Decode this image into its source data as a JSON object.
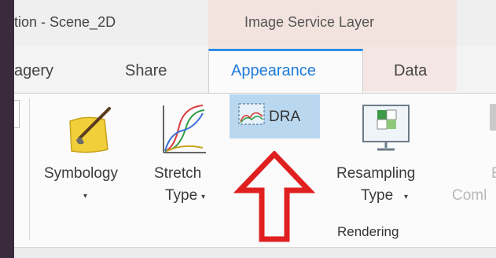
{
  "window": {
    "title": "tion - Scene_2D",
    "context_group": "Image Service Layer"
  },
  "tabs": {
    "imagery": "agery",
    "share": "Share",
    "appearance": "Appearance",
    "data": "Data",
    "active": "Appearance"
  },
  "ribbon": {
    "symbology": {
      "label": "Symbology",
      "caret": "▾"
    },
    "stretch_type": {
      "line1": "Stretch",
      "line2": "Type",
      "caret": "▾"
    },
    "dra": {
      "label": "DRA"
    },
    "resampling_type": {
      "line1": "Resampling",
      "line2": "Type",
      "caret": "▾"
    },
    "partial_button": {
      "line1": "E",
      "line2": "Coml"
    },
    "group_label": "Rendering"
  },
  "annotation": {
    "arrow_color": "#e02020",
    "points_to": "DRA"
  },
  "colors": {
    "accent": "#1f7ad8",
    "dra_highlight": "#b9d7ef",
    "context_tint": "#f2e3de"
  }
}
